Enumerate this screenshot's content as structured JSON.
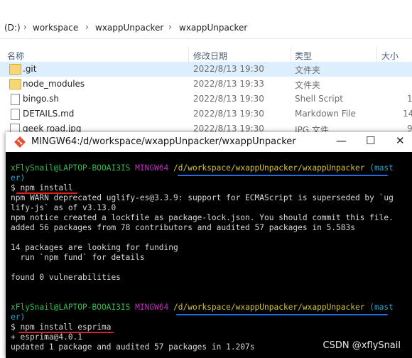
{
  "explorer": {
    "breadcrumb": [
      "(D:)",
      "workspace",
      "wxappUnpacker",
      "wxappUnpacker"
    ],
    "columns": {
      "name": "名称",
      "modified": "修改日期",
      "type": "类型",
      "size": "大小"
    },
    "files": [
      {
        "name": ".git",
        "modified": "2022/8/13 19:30",
        "type": "文件夹",
        "size": "",
        "icon": "folder-icon"
      },
      {
        "name": "node_modules",
        "modified": "2022/8/13 19:33",
        "type": "文件夹",
        "size": "",
        "icon": "folder-icon"
      },
      {
        "name": "bingo.sh",
        "modified": "2022/8/13 19:30",
        "type": "Shell Script",
        "size": "1",
        "icon": "document-icon"
      },
      {
        "name": "DETAILS.md",
        "modified": "2022/8/13 19:30",
        "type": "Markdown File",
        "size": "14",
        "icon": "document-icon"
      },
      {
        "name": "geek road.jpg",
        "modified": "2022/8/13 19:30",
        "type": "JPG 文件",
        "size": "9",
        "icon": "image-icon"
      }
    ]
  },
  "terminal": {
    "title": "MINGW64:/d/workspace/wxappUnpacker/wxappUnpacker",
    "lines": {
      "prompt1_user": "xFlySnail@LAPTOP-BOOAI3IS",
      "prompt1_env": "MINGW64",
      "prompt1_path": "/d/workspace/wxappUnpacker/wxappUnpacker",
      "prompt1_branch_a": "(mast",
      "prompt1_branch_b": "er)",
      "cmd1": "$ npm install",
      "out1": "npm WARN deprecated uglify-es@3.3.9: support for ECMAScript is superseded by `ug",
      "out2": "lify-js` as of v3.13.0",
      "out3": "npm notice created a lockfile as package-lock.json. You should commit this file.",
      "out4": "added 56 packages from 78 contributors and audited 57 packages in 5.583s",
      "out5": "14 packages are looking for funding",
      "out6": "  run `npm fund` for details",
      "out7": "found 0 vulnerabilities",
      "prompt2_user": "xFlySnail@LAPTOP-BOOAI3IS",
      "prompt2_env": "MINGW64",
      "prompt2_path": "/d/workspace/wxappUnpacker/wxappUnpacker",
      "prompt2_branch_a": "(mast",
      "prompt2_branch_b": "er)",
      "cmd2": "$ npm install esprima",
      "out8": "+ esprima@4.0.1",
      "out9": "updated 1 package and audited 57 packages in 1.207s"
    },
    "controls": {
      "minimize": "—",
      "maximize": "☐",
      "close": "✕"
    }
  },
  "watermark": "CSDN @xflySnail",
  "colors": {
    "prompt_user": "#2fbf4a",
    "prompt_env": "#c02ec0",
    "prompt_path": "#d4c43a",
    "branch": "#2fa4c8",
    "annotation_red": "#e0201e",
    "annotation_blue": "#1e6ee8"
  }
}
